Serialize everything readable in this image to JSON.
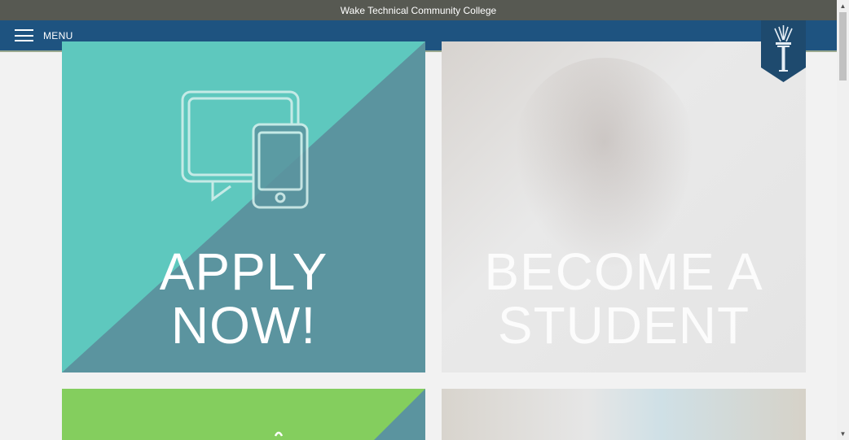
{
  "topbar": {
    "title": "Wake Technical Community College"
  },
  "nav": {
    "menu_label": "MENU"
  },
  "tiles": [
    {
      "label_line1": "APPLY",
      "label_line2": "NOW!",
      "color_light": "#5ec8be",
      "color_dark": "#5b949f"
    },
    {
      "label_line1": "BECOME A",
      "label_line2": "STUDENT"
    }
  ],
  "colors": {
    "topbar": "#575952",
    "navbar": "#1e5380",
    "green_tile": "#84ce5e",
    "green_tile_dark": "#5b949f"
  },
  "icons": {
    "menu": "hamburger-icon",
    "logo": "wake-tech-logo-icon",
    "apply": "devices-icon"
  }
}
